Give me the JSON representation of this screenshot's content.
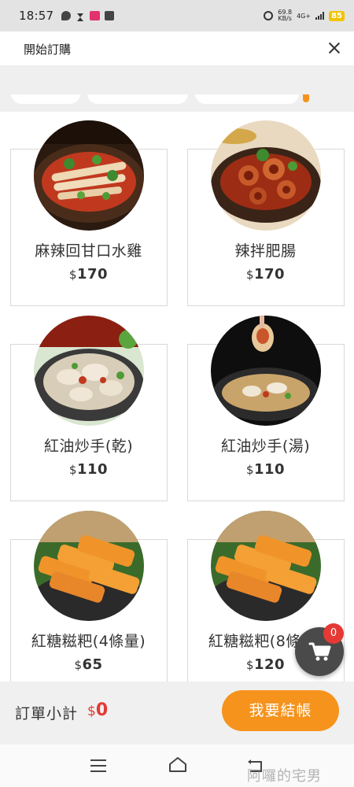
{
  "status_bar": {
    "time": "18:57",
    "speed_value": "69.8",
    "speed_unit": "KB/s",
    "network": "4G+",
    "battery": "85"
  },
  "header": {
    "title": "開始訂購",
    "close_icon": "close-icon"
  },
  "products": [
    {
      "name": "麻辣回甘口水雞",
      "currency": "$",
      "price": "170",
      "image": "spicy-chicken"
    },
    {
      "name": "辣拌肥腸",
      "currency": "$",
      "price": "170",
      "image": "spicy-intestine"
    },
    {
      "name": "紅油炒手(乾)",
      "currency": "$",
      "price": "110",
      "image": "wonton-dry"
    },
    {
      "name": "紅油炒手(湯)",
      "currency": "$",
      "price": "110",
      "image": "wonton-soup"
    },
    {
      "name": "紅糖糍粑(4條量)",
      "currency": "$",
      "price": "65",
      "image": "brown-sugar-cake"
    },
    {
      "name": "紅糖糍粑(8條量)",
      "currency": "$",
      "price": "120",
      "image": "brown-sugar-cake"
    }
  ],
  "cart": {
    "icon": "cart-icon",
    "badge_count": "0"
  },
  "order_bar": {
    "subtotal_label": "訂單小計",
    "currency": "$",
    "subtotal": "0",
    "checkout_label": "我要結帳"
  },
  "nav_bar": {
    "icons": [
      "menu-icon",
      "home-icon",
      "back-icon"
    ]
  },
  "watermark": "阿囉的宅男",
  "colors": {
    "accent": "#f6931d",
    "badge": "#e53935",
    "cart_fab": "#4a4a4a"
  }
}
